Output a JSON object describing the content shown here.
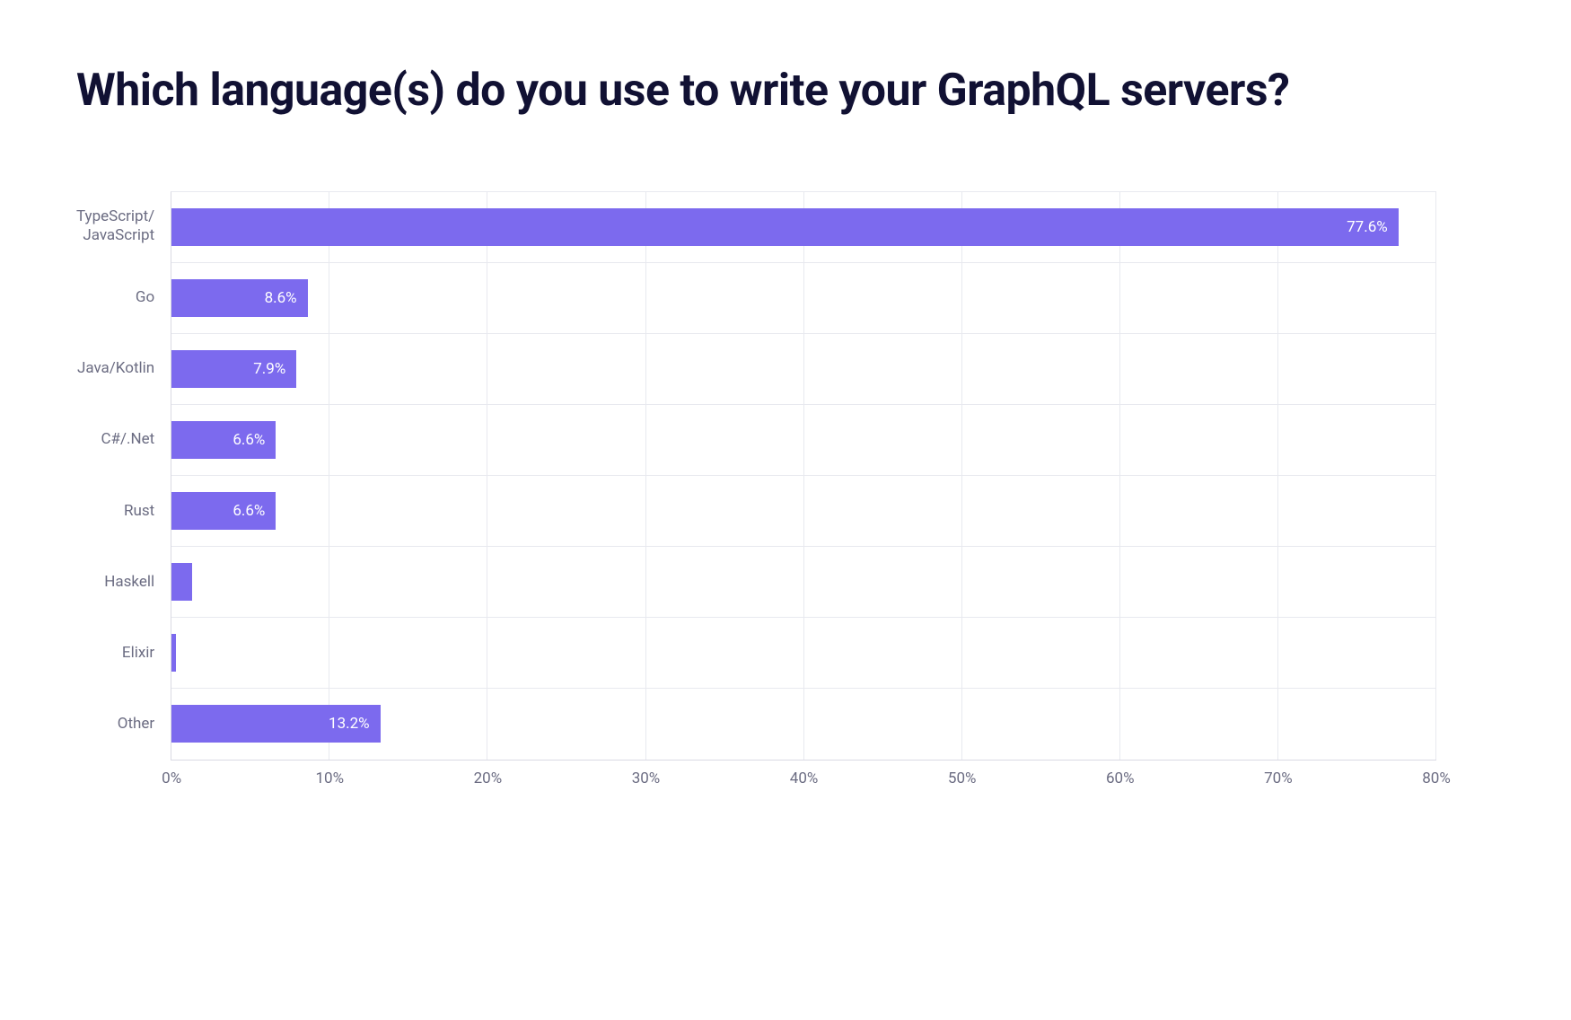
{
  "title": "Which language(s) do you use\nto write your GraphQL servers?",
  "chart_data": {
    "type": "bar",
    "orientation": "horizontal",
    "categories": [
      "TypeScript/\nJavaScript",
      "Go",
      "Java/Kotlin",
      "C#/.Net",
      "Rust",
      "Haskell",
      "Elixir",
      "Other"
    ],
    "values": [
      77.6,
      8.6,
      7.9,
      6.6,
      6.6,
      1.3,
      0.3,
      13.2
    ],
    "value_labels": [
      "77.6%",
      "8.6%",
      "7.9%",
      "6.6%",
      "6.6%",
      "",
      "",
      "13.2%"
    ],
    "xlim": [
      0,
      80
    ],
    "x_ticks": [
      0,
      10,
      20,
      30,
      40,
      50,
      60,
      70,
      80
    ],
    "x_tick_labels": [
      "0%",
      "10%",
      "20%",
      "30%",
      "40%",
      "50%",
      "60%",
      "70%",
      "80%"
    ],
    "bar_color": "#7c6aee"
  }
}
